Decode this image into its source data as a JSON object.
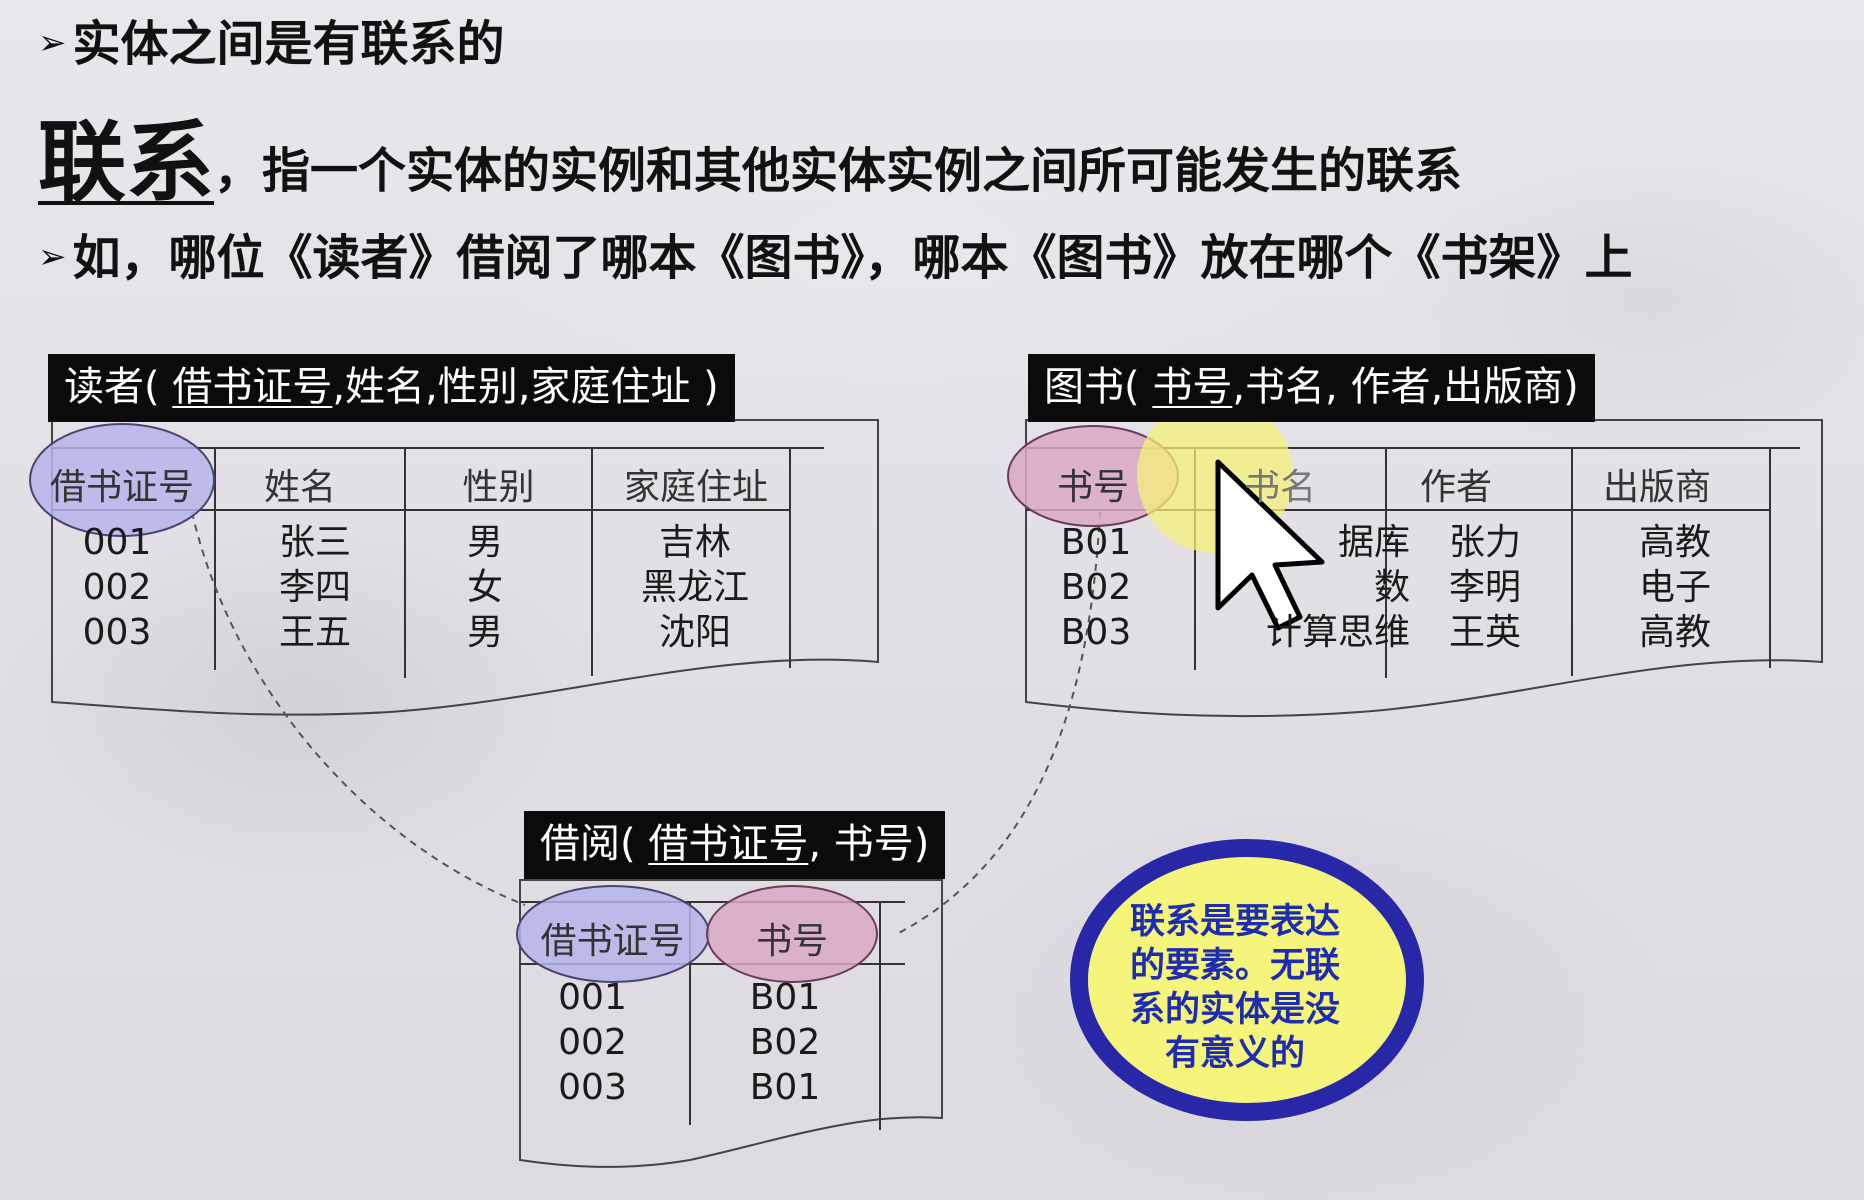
{
  "heading": {
    "line1_arrow": "➢",
    "line1": "实体之间是有联系的",
    "term": "联系",
    "definition": "，指一个实体的实例和其他实体实例之间所可能发生的联系",
    "line3_arrow": "➢",
    "example": "如，哪位《读者》借阅了哪本《图书》，哪本《图书》放在哪个《书架》上"
  },
  "reader_table": {
    "title_prefix": "读者( ",
    "title_key": "借书证号",
    "title_suffix": ",姓名,性别,家庭住址 )",
    "headers": [
      "借书证号",
      "姓名",
      "性别",
      "家庭住址"
    ],
    "columns": [
      "001\n002\n003",
      "张三\n李四\n王五",
      "男\n女\n男",
      "吉林\n黑龙江\n沈阳"
    ]
  },
  "book_table": {
    "title_prefix": "图书( ",
    "title_key": "书号",
    "title_suffix": ",书名, 作者,出版商)",
    "headers": [
      "书号",
      "书名",
      "作者",
      "出版商"
    ],
    "columns": [
      "B01\nB02\nB03",
      "据库\n数\n计算思维",
      "张力\n李明\n王英",
      "高教\n电子\n高教"
    ]
  },
  "borrow_table": {
    "title_prefix": "借阅( ",
    "title_key": "借书证号",
    "title_suffix": ", 书号)",
    "headers": [
      "借书证号",
      "书号"
    ],
    "columns": [
      "001\n002\n003",
      "B01\nB02\nB01"
    ]
  },
  "note": "联系是要表达的要素。无联系的实体是没有意义的",
  "colors": {
    "reader_key_ellipse": "#b6b4ea",
    "book_key_ellipse": "#dba9c4",
    "note_ring": "#2727a8",
    "note_fill": "#f4f57a",
    "note_text": "#1e2db0",
    "cursor_highlight": "#f6f07a"
  }
}
